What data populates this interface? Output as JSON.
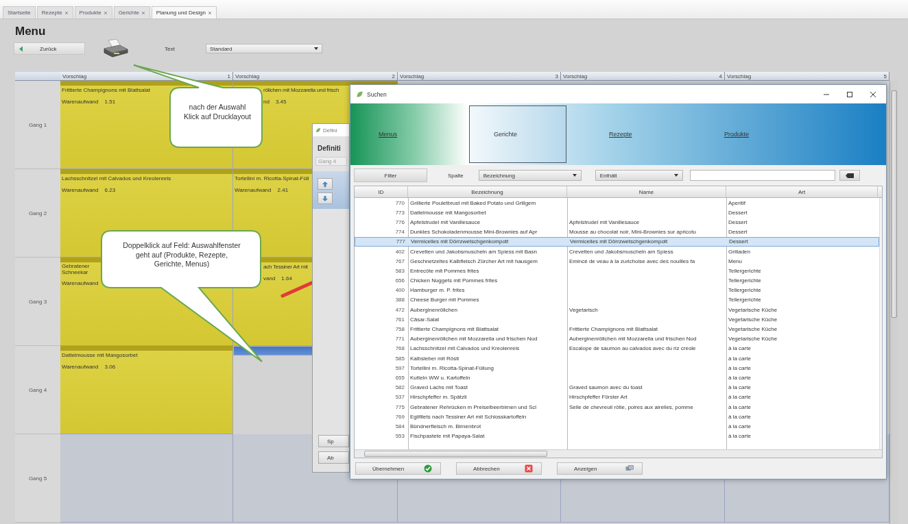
{
  "tabs": [
    {
      "label": "Startseite",
      "closable": false,
      "selected": false
    },
    {
      "label": "Rezepte",
      "closable": true,
      "selected": false
    },
    {
      "label": "Produkte",
      "closable": true,
      "selected": false
    },
    {
      "label": "Gerichte",
      "closable": true,
      "selected": false
    },
    {
      "label": "Planung und Design",
      "closable": true,
      "selected": true
    }
  ],
  "page": {
    "title": "Menu",
    "back_button": "Zurück",
    "text_label": "Text",
    "text_select": "Standard"
  },
  "grid": {
    "columns": [
      {
        "label": "Vorschlag",
        "number": "1"
      },
      {
        "label": "Vorschlag",
        "number": "2"
      },
      {
        "label": "Vorschlag",
        "number": "3"
      },
      {
        "label": "Vorschlag",
        "number": "4"
      },
      {
        "label": "Vorschlag",
        "number": "5"
      }
    ],
    "rows": [
      {
        "label": "Gang 1",
        "cells": [
          {
            "kind": "dish",
            "selected": false,
            "lines": [
              "Frittierte Champignons mit Blattsalat"
            ],
            "cost_label": "Warenaufwand",
            "cost": "1.51"
          },
          {
            "kind": "dish_partial",
            "selected": false,
            "lines": [
              "röllchen mit Mozzarella und frisch"
            ],
            "cost_label": "nd",
            "cost": "3.45"
          }
        ]
      },
      {
        "label": "Gang 2",
        "cells": [
          {
            "kind": "dish",
            "selected": false,
            "lines": [
              "Lachsschnitzel mit Calvados und Kreolenreis"
            ],
            "cost_label": "Warenaufwand",
            "cost": "6.23"
          },
          {
            "kind": "dish",
            "selected": false,
            "lines": [
              "Tortellini m. Ricotta-Spinat-Füll"
            ],
            "cost_label": "Warenaufwand",
            "cost": "2.41"
          }
        ]
      },
      {
        "label": "Gang 3",
        "cells": [
          {
            "kind": "dish",
            "selected": false,
            "lines": [
              "Gebratener",
              "Schneekar"
            ],
            "cost_label": "Warenaufwand"
          },
          {
            "kind": "dish_partial",
            "selected": false,
            "lines": [
              "ach Tessiner Art mit"
            ],
            "cost_label": "vand",
            "cost": "1.64"
          }
        ]
      },
      {
        "label": "Gang 4",
        "cells": [
          {
            "kind": "dish",
            "selected": false,
            "lines": [
              "Dattelmousse mit Mangosorbet"
            ],
            "cost_label": "Warenaufwand",
            "cost": "3.06"
          },
          {
            "kind": "empty",
            "selected": true
          }
        ]
      },
      {
        "label": "Gang 5",
        "cells": [
          {
            "kind": "empty",
            "selected": false
          },
          {
            "kind": "empty",
            "selected": false
          },
          {
            "kind": "empty",
            "selected": false
          },
          {
            "kind": "empty",
            "selected": false
          },
          {
            "kind": "empty",
            "selected": false
          }
        ]
      }
    ]
  },
  "callouts": [
    {
      "lines": [
        "nach der Auswahl",
        "Klick auf Drucklayout"
      ]
    },
    {
      "lines": [
        "Doppelklick auf Feld: Auswahlfenster",
        "geht auf (Produkte, Rezepte,",
        "Gerichte, Menus)"
      ]
    }
  ],
  "definition_window": {
    "title": "Defini",
    "heading": "Definiti",
    "field": "Gang 4",
    "buttons": [
      "Sp",
      "Ab"
    ]
  },
  "search_window": {
    "title": "Suchen",
    "tabs": [
      {
        "label": "Menus",
        "selected": false
      },
      {
        "label": "Gerichte",
        "selected": true
      },
      {
        "label": "Rezepte",
        "selected": false
      },
      {
        "label": "Produkte",
        "selected": false
      }
    ],
    "filter_button": "Filter",
    "column_label": "Spalte",
    "column_select": "Bezeichnung",
    "operator_select": "Enthält",
    "table": {
      "columns": [
        "ID",
        "Bezeichnung",
        "Name",
        "Art"
      ],
      "rows": [
        {
          "id": "770",
          "bezeichnung": "Grillierte Pouletbrust mit Baked Potato und Grillgem",
          "art": "Aperitif",
          "selected": false
        },
        {
          "id": "773",
          "bezeichnung": "Dattelmousse mit Mangosorbet",
          "art": "Dessert",
          "selected": false
        },
        {
          "id": "776",
          "bezeichnung": "Apfelstrudel mit Vanillesauce",
          "name": "Apfelstrudel mit Vanillesauce",
          "art": "Dessert",
          "selected": false
        },
        {
          "id": "774",
          "bezeichnung": "Dunkles Schokoladenmousse Mini-Brownies auf Apr",
          "name": "Mousse au chocolat noir, Mini-Brownies sur apricotu",
          "art": "Dessert",
          "selected": false
        },
        {
          "id": "777",
          "bezeichnung": "Vermicelles mit Dörrzwetschgenkompott",
          "name": "Vermicelles mit Dörrzwetschgenkompott",
          "art": "Dessert",
          "selected": true
        },
        {
          "id": "402",
          "bezeichnung": "Crevetten und Jakobsmuscheln am Spiess mit Basn",
          "name": "Crevetten und Jakobsmuscheln am Spiess",
          "art": "Grilladen",
          "selected": false
        },
        {
          "id": "767",
          "bezeichnung": "Geschnetzeltes Kalbfleisch Zürcher Art mit hausgem",
          "name": "Emincé de veau à la zurichoise avec des nouilles fa",
          "art": "Menu",
          "selected": false
        },
        {
          "id": "583",
          "bezeichnung": "Entrecôte mit Pommes frites",
          "art": "Tellergerichte",
          "selected": false
        },
        {
          "id": "656",
          "bezeichnung": "Chicken Nuggets mit Pommes frites",
          "art": "Tellergerichte",
          "selected": false
        },
        {
          "id": "400",
          "bezeichnung": "Hamburger m. P. frites",
          "art": "Tellergerichte",
          "selected": false
        },
        {
          "id": "388",
          "bezeichnung": "Cheese Burger mit Pommes",
          "art": "Tellergerichte",
          "selected": false
        },
        {
          "id": "472",
          "bezeichnung": "Auberginenröllchen",
          "name": "Vegetarisch",
          "art": "Vegetarische Küche",
          "selected": false
        },
        {
          "id": "761",
          "bezeichnung": "Cäsar-Salat",
          "art": "Vegetarische Küche",
          "selected": false
        },
        {
          "id": "758",
          "bezeichnung": "Frittierte Champignons mit Blattsalat",
          "name": "Frittierte Champignons mit Blattsalat",
          "art": "Vegetarische Küche",
          "selected": false
        },
        {
          "id": "771",
          "bezeichnung": "Auberginenröllchen mit Mozzarella und frischen Nud",
          "name": "Auberginenröllchen mit Mozzarella und frischen Nud",
          "art": "Vegetarische Küche",
          "selected": false
        },
        {
          "id": "768",
          "bezeichnung": "Lachsschnitzel mit Calvados und Kreolenreis",
          "name": "Escalope de saumon au calvados avec du riz creole",
          "art": "à la carte",
          "selected": false
        },
        {
          "id": "585",
          "bezeichnung": "Kalbsleber mit Rösti",
          "art": "à la carte",
          "selected": false
        },
        {
          "id": "597",
          "bezeichnung": "Tortellini m. Ricotta-Spinat-Füllung",
          "art": "à la carte",
          "selected": false
        },
        {
          "id": "655",
          "bezeichnung": "Kutteln WW u. Kartoffeln",
          "art": "à la carte",
          "selected": false
        },
        {
          "id": "582",
          "bezeichnung": "Graved Lachs mit Toast",
          "name": "Graved saumon avec du toast",
          "art": "à la carte",
          "selected": false
        },
        {
          "id": "537",
          "bezeichnung": "Hirschpfeffer m. Spätzli",
          "name": "Hirschpfeffer Förster Art",
          "art": "à la carte",
          "selected": false
        },
        {
          "id": "775",
          "bezeichnung": "Gebratener Rehrücken m Preiselbeerbirnen und Scl",
          "name": "Selle de chevreuil rôtie, poires aux airelles, pomme",
          "art": "à la carte",
          "selected": false
        },
        {
          "id": "769",
          "bezeichnung": "Eglifilets nach Tessiner Art mit Schlosskartoffeln",
          "art": "à la carte",
          "selected": false
        },
        {
          "id": "584",
          "bezeichnung": "Bündnerfleisch m. Birnenbrot",
          "art": "à la carte",
          "selected": false
        },
        {
          "id": "553",
          "bezeichnung": "Fischpastete mit Papaya-Salat",
          "art": "à la carte",
          "selected": false
        }
      ]
    },
    "buttons": [
      {
        "label": "Übernehmen",
        "kind": "ok"
      },
      {
        "label": "Abbrechen",
        "kind": "cancel"
      },
      {
        "label": "Anzeigen",
        "kind": "show"
      }
    ]
  }
}
